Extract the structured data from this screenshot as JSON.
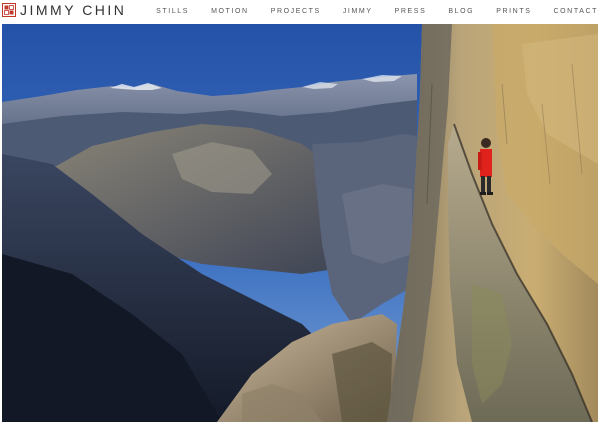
{
  "brand": {
    "name": "JIMMY CHIN",
    "logo_icon": "red-seal-icon",
    "logo_color": "#c0392b"
  },
  "nav": {
    "items": [
      {
        "label": "STILLS"
      },
      {
        "label": "MOTION"
      },
      {
        "label": "PROJECTS"
      },
      {
        "label": "JIMMY"
      },
      {
        "label": "PRESS"
      },
      {
        "label": "BLOG"
      },
      {
        "label": "PRINTS"
      },
      {
        "label": "CONTACT"
      }
    ]
  },
  "hero": {
    "accent_jacket_color": "#e0221c",
    "sky_color": "#2f5fb0"
  }
}
